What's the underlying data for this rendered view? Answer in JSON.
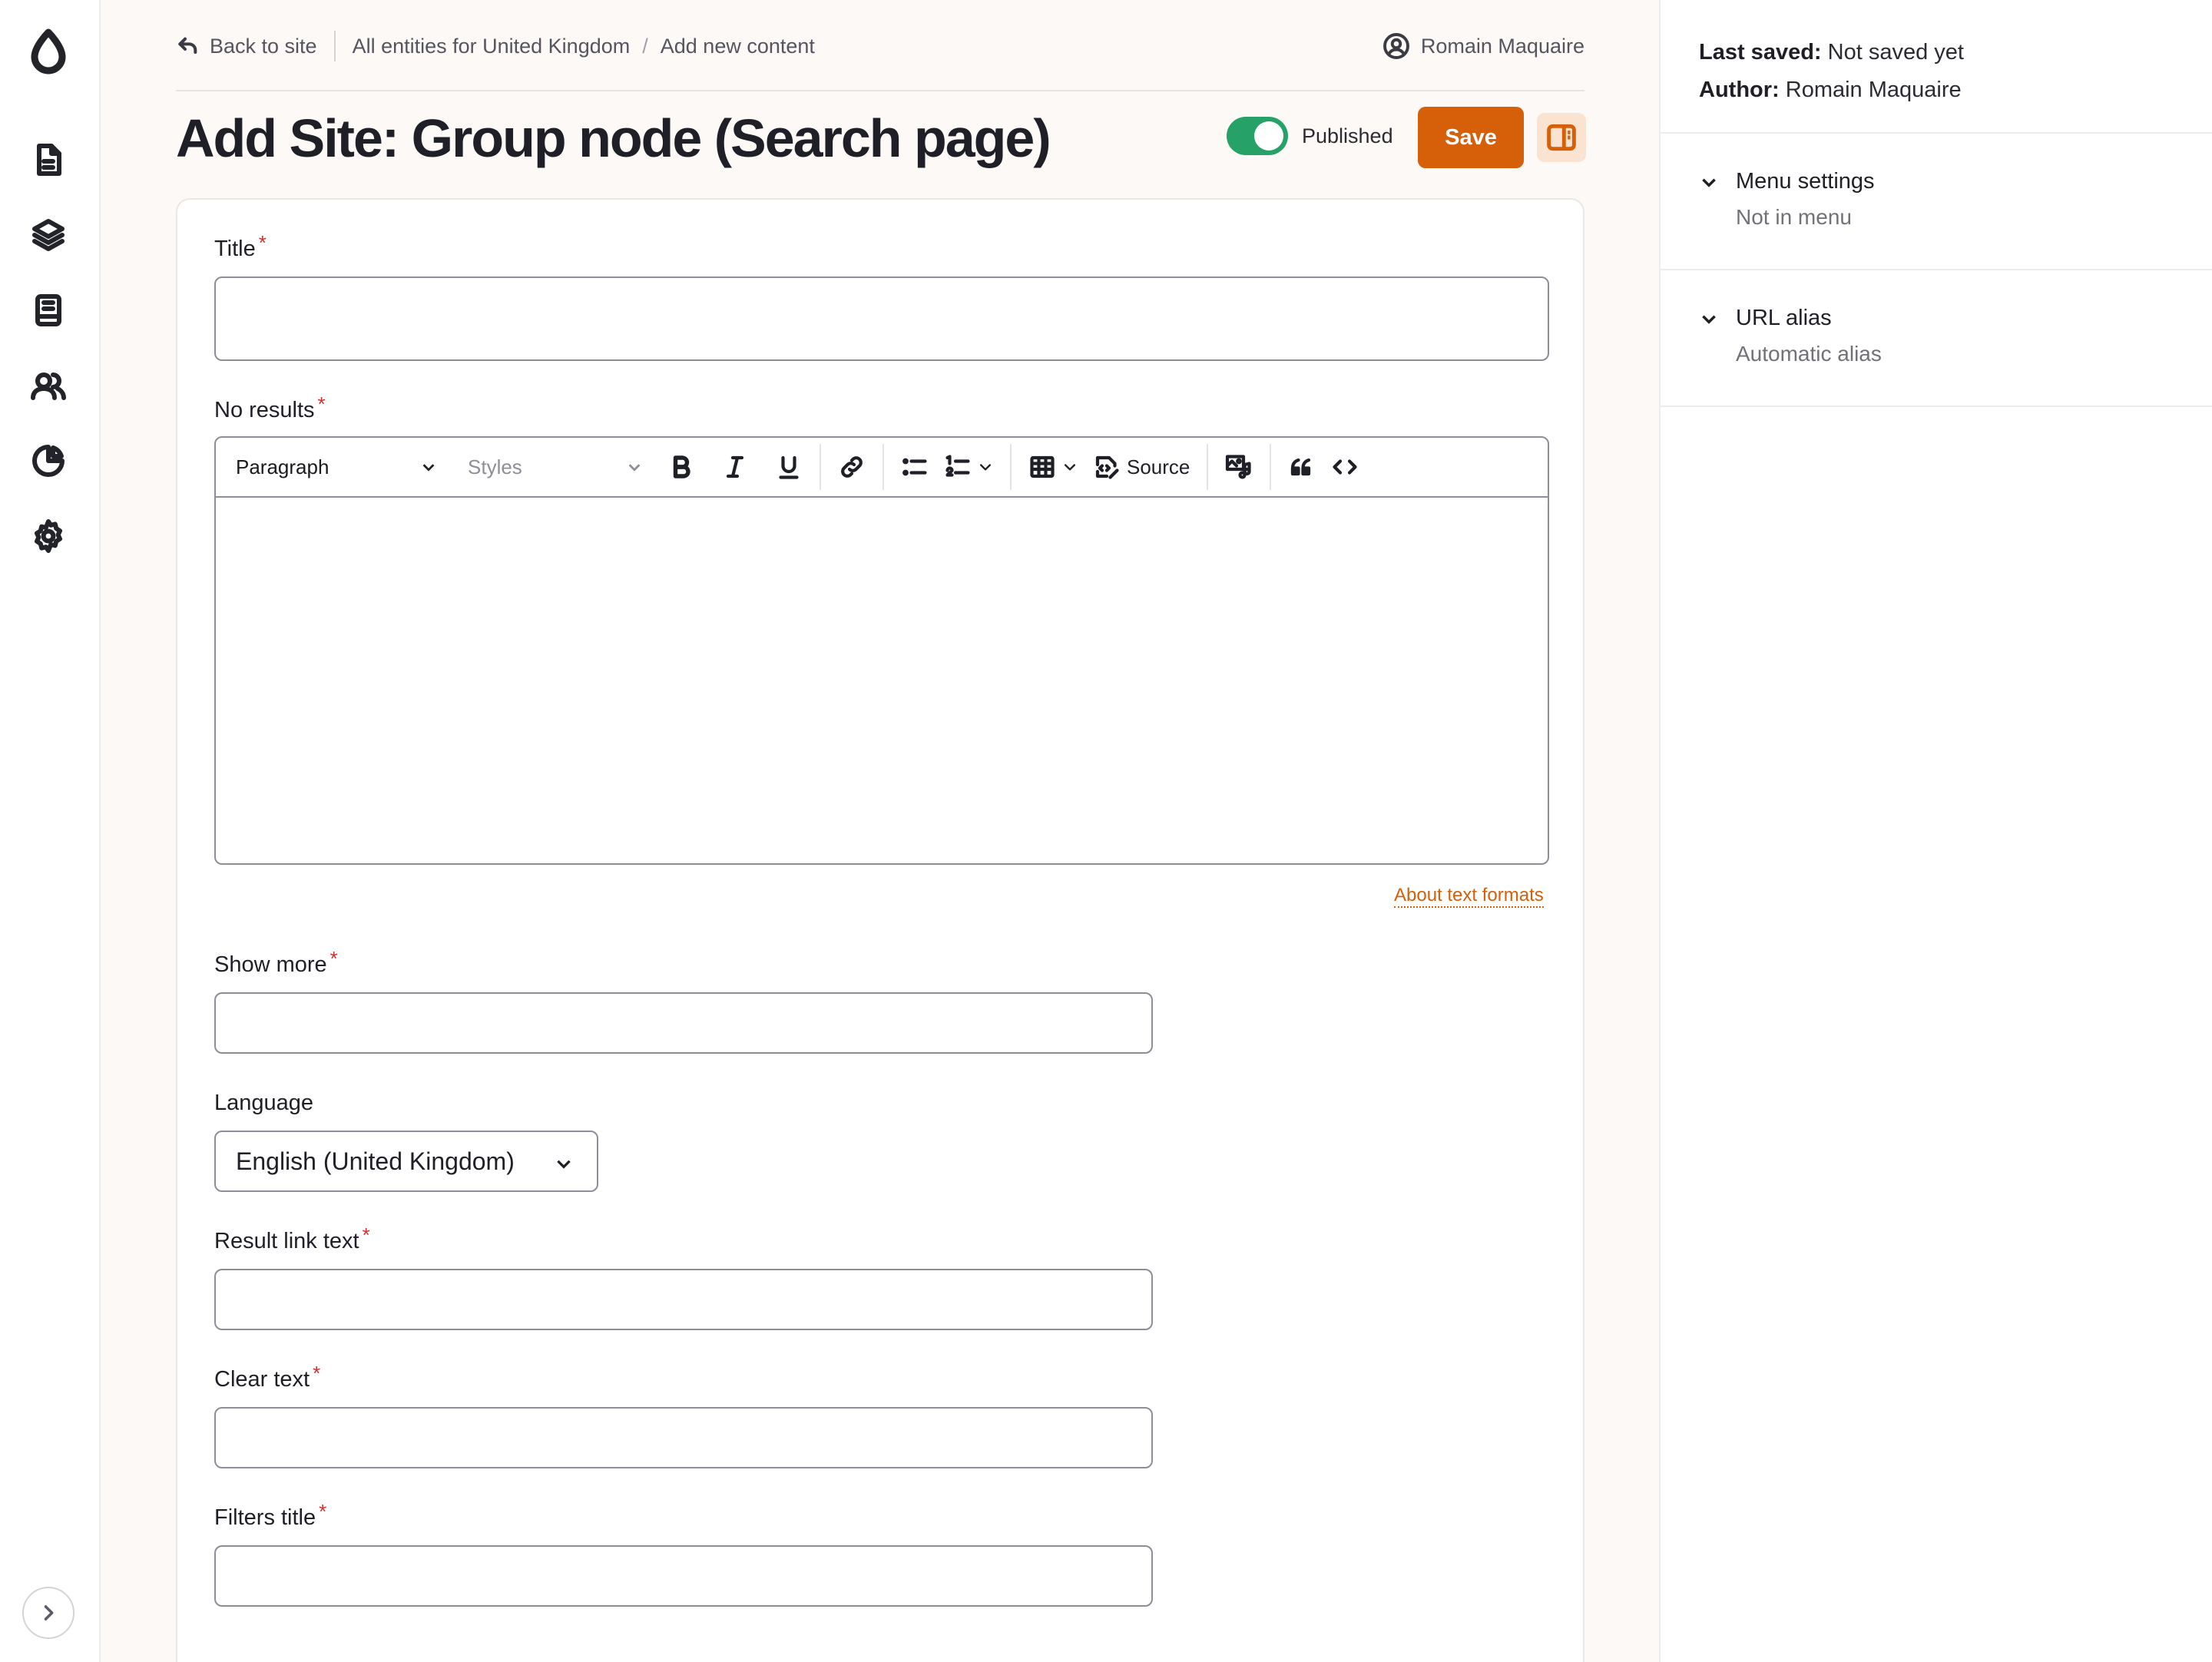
{
  "rail": {
    "icons": [
      "drupal-logo-icon",
      "content-icon",
      "structure-icon",
      "book-icon",
      "people-icon",
      "reports-icon",
      "settings-icon",
      "expand-icon"
    ]
  },
  "header": {
    "back_label": "Back to site",
    "breadcrumb": [
      "All entities for United Kingdom",
      "Add new content"
    ],
    "breadcrumb_sep": "/",
    "user_name": "Romain Maquaire",
    "page_title": "Add Site: Group node (Search page)",
    "published_label": "Published",
    "published": true,
    "save_label": "Save"
  },
  "form": {
    "title_label": "Title",
    "no_results_label": "No results",
    "toolbar": {
      "paragraph": "Paragraph",
      "styles": "Styles",
      "source": "Source"
    },
    "about_text_formats": "About text formats",
    "show_more_label": "Show more",
    "language_label": "Language",
    "language_value": "English (United Kingdom)",
    "result_link_text_label": "Result link text",
    "clear_text_label": "Clear text",
    "filters_title_label": "Filters title",
    "required_mark": "*"
  },
  "sidebar": {
    "last_saved_label": "Last saved:",
    "last_saved_value": "Not saved yet",
    "author_label": "Author:",
    "author_value": "Romain Maquaire",
    "menu_settings": "Menu settings",
    "menu_settings_sub": "Not in menu",
    "url_alias": "URL alias",
    "url_alias_sub": "Automatic alias"
  },
  "colors": {
    "accent": "#d65f0a",
    "toggle_on": "#26a269",
    "required": "#d0302f"
  }
}
